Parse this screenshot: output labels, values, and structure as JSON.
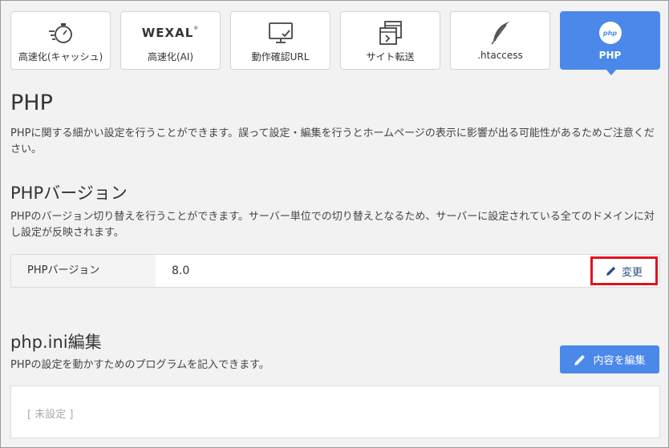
{
  "tabs": [
    {
      "label": "高速化(キャッシュ)",
      "icon": "stopwatch-icon",
      "active": false
    },
    {
      "label": "高速化(AI)",
      "icon": "wexal-logo",
      "logo_text": "WEXAL",
      "active": false
    },
    {
      "label": "動作確認URL",
      "icon": "monitor-check-icon",
      "active": false
    },
    {
      "label": "サイト転送",
      "icon": "site-transfer-icon",
      "active": false
    },
    {
      "label": ".htaccess",
      "icon": "feather-icon",
      "active": false
    },
    {
      "label": "PHP",
      "icon": "php-icon",
      "badge_text": "php",
      "active": true
    }
  ],
  "page": {
    "title": "PHP",
    "description": "PHPに関する細かい設定を行うことができます。誤って設定・編集を行うとホームページの表示に影響が出る可能性があるためご注意ください。"
  },
  "php_version": {
    "heading": "PHPバージョン",
    "description": "PHPのバージョン切り替えを行うことができます。サーバー単位での切り替えとなるため、サーバーに設定されている全てのドメインに対し設定が反映されます。",
    "row_label": "PHPバージョン",
    "value": "8.0",
    "change_label": "変更"
  },
  "php_ini": {
    "heading": "php.ini編集",
    "description": "PHPの設定を動かすためのプログラムを記入できます。",
    "edit_label": "内容を編集",
    "content_placeholder": "[ 未設定 ]"
  },
  "colors": {
    "accent": "#4a88ea",
    "highlight_border": "#e0141e",
    "background": "#f2f2f2"
  }
}
